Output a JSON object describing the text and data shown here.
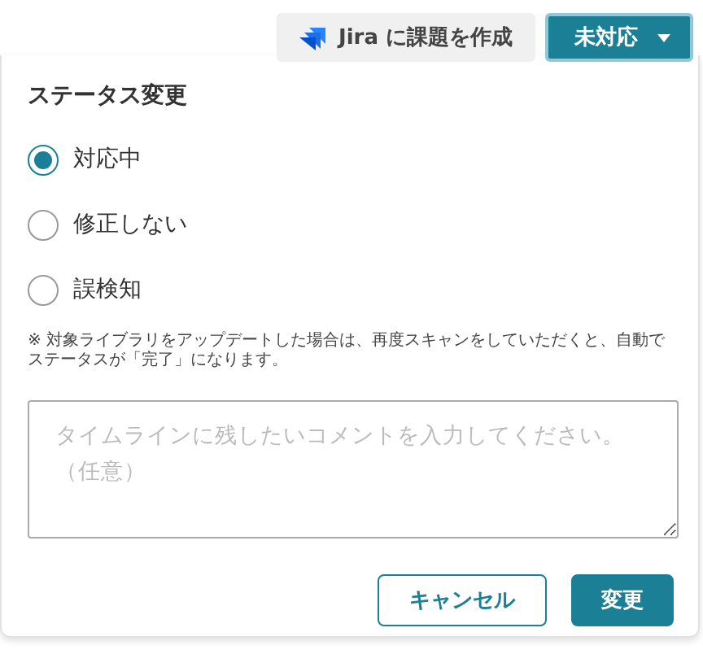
{
  "toolbar": {
    "jira_button": "Jira に課題を作成",
    "status_button": "未対応"
  },
  "panel": {
    "title": "ステータス変更",
    "options": [
      {
        "label": "対応中",
        "selected": true
      },
      {
        "label": "修正しない",
        "selected": false
      },
      {
        "label": "誤検知",
        "selected": false
      }
    ],
    "note": "※ 対象ライブラリをアップデートした場合は、再度スキャンをしていただくと、自動でステータスが「完了」になります。",
    "comment": {
      "placeholder": "タイムラインに残したいコメントを入力してください。（任意）"
    },
    "buttons": [
      {
        "label": "キャンセル",
        "kind": "secondary"
      },
      {
        "label": "変更",
        "kind": "primary"
      }
    ]
  }
}
